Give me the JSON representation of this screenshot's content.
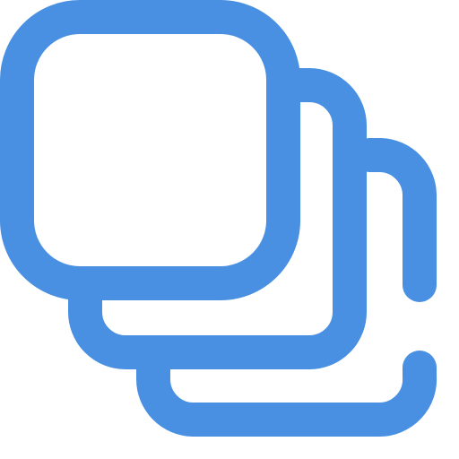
{
  "icon": {
    "name": "stacked-squares-icon",
    "color": "#4A90E2"
  }
}
